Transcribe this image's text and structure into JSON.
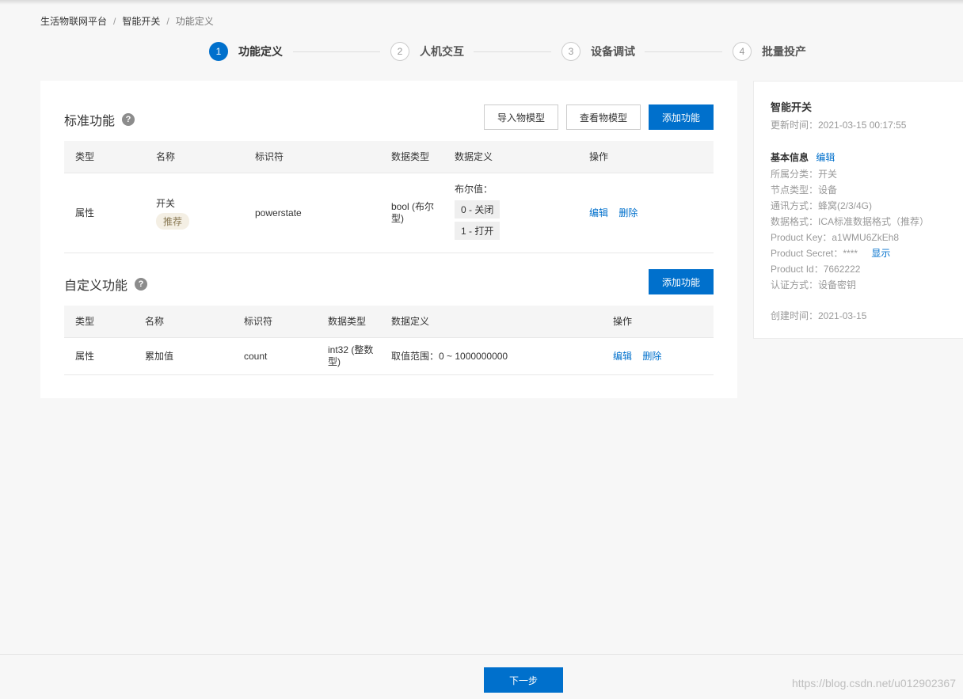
{
  "breadcrumb": {
    "items": [
      "生活物联网平台",
      "智能开关",
      "功能定义"
    ],
    "separator": "/"
  },
  "steps": [
    {
      "num": "1",
      "label": "功能定义",
      "active": true
    },
    {
      "num": "2",
      "label": "人机交互",
      "active": false
    },
    {
      "num": "3",
      "label": "设备调试",
      "active": false
    },
    {
      "num": "4",
      "label": "批量投产",
      "active": false
    }
  ],
  "standard": {
    "title": "标准功能",
    "help": "?",
    "buttons": {
      "import": "导入物模型",
      "view": "查看物模型",
      "add": "添加功能"
    },
    "columns": [
      "类型",
      "名称",
      "标识符",
      "数据类型",
      "数据定义",
      "操作"
    ],
    "rows": [
      {
        "type": "属性",
        "name": "开关",
        "badge": "推荐",
        "identifier": "powerstate",
        "data_type": "bool (布尔型)",
        "definition_label": "布尔值：",
        "definition_values": [
          "0 - 关闭",
          "1 - 打开"
        ],
        "actions": [
          "编辑",
          "删除"
        ]
      }
    ]
  },
  "custom": {
    "title": "自定义功能",
    "help": "?",
    "buttons": {
      "add": "添加功能"
    },
    "columns": [
      "类型",
      "名称",
      "标识符",
      "数据类型",
      "数据定义",
      "操作"
    ],
    "rows": [
      {
        "type": "属性",
        "name": "累加值",
        "identifier": "count",
        "data_type": "int32 (整数型)",
        "definition": "取值范围：0 ~ 1000000000",
        "actions": [
          "编辑",
          "删除"
        ]
      }
    ]
  },
  "side": {
    "product_name": "智能开关",
    "updated": "更新时间：2021-03-15 00:17:55",
    "basic_title": "基本信息",
    "basic_edit": "编辑",
    "category": "所属分类：开关",
    "node_type": "节点类型：设备",
    "network": "通讯方式：蜂窝(2/3/4G)",
    "data_format": "数据格式：ICA标准数据格式（推荐）",
    "product_key": "Product Key：a1WMU6ZkEh8",
    "product_secret": "Product Secret：****",
    "show_link": "显示",
    "product_id": "Product Id：7662222",
    "auth": "认证方式：设备密钥",
    "created": "创建时间：2021-03-15"
  },
  "footer": {
    "next_label": "下一步"
  },
  "watermark": "https://blog.csdn.net/u012902367",
  "colors": {
    "primary": "#0070cc",
    "background": "#f7f7f7"
  }
}
